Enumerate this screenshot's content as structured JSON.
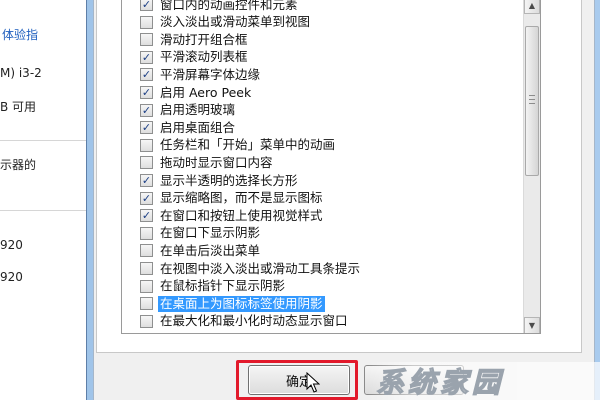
{
  "background_window": {
    "texts": [
      {
        "id": "link",
        "text": "体验指"
      },
      {
        "id": "cpu",
        "text": "M) i3-2"
      },
      {
        "id": "ram",
        "text": "B 可用"
      },
      {
        "id": "display",
        "text": "示器的"
      },
      {
        "id": "res1",
        "text": "920"
      },
      {
        "id": "res2",
        "text": "920"
      }
    ]
  },
  "dialog": {
    "options": [
      {
        "label": "窗口内的动画控件和元素",
        "checked": true
      },
      {
        "label": "淡入淡出或滑动菜单到视图",
        "checked": false
      },
      {
        "label": "滑动打开组合框",
        "checked": false
      },
      {
        "label": "平滑滚动列表框",
        "checked": true
      },
      {
        "label": "平滑屏幕字体边缘",
        "checked": true
      },
      {
        "label": "启用 Aero Peek",
        "checked": true
      },
      {
        "label": "启用透明玻璃",
        "checked": true
      },
      {
        "label": "启用桌面组合",
        "checked": true
      },
      {
        "label": "任务栏和「开始」菜单中的动画",
        "checked": false
      },
      {
        "label": "拖动时显示窗口内容",
        "checked": false
      },
      {
        "label": "显示半透明的选择长方形",
        "checked": true
      },
      {
        "label": "显示缩略图，而不是显示图标",
        "checked": true
      },
      {
        "label": "在窗口和按钮上使用视觉样式",
        "checked": true
      },
      {
        "label": "在窗口下显示阴影",
        "checked": false
      },
      {
        "label": "在单击后淡出菜单",
        "checked": false
      },
      {
        "label": "在视图中淡入淡出或滑动工具条提示",
        "checked": false
      },
      {
        "label": "在鼠标指针下显示阴影",
        "checked": false
      },
      {
        "label": "在桌面上为图标标签使用阴影",
        "checked": false,
        "selected": true
      },
      {
        "label": "在最大化和最小化时动态显示窗口",
        "checked": false
      }
    ],
    "ok_label": "确定"
  },
  "watermark": {
    "text": "系统家园"
  },
  "colors": {
    "selection": "#3399ff",
    "highlight_border": "#e2192b",
    "check": "#1c3f85"
  }
}
